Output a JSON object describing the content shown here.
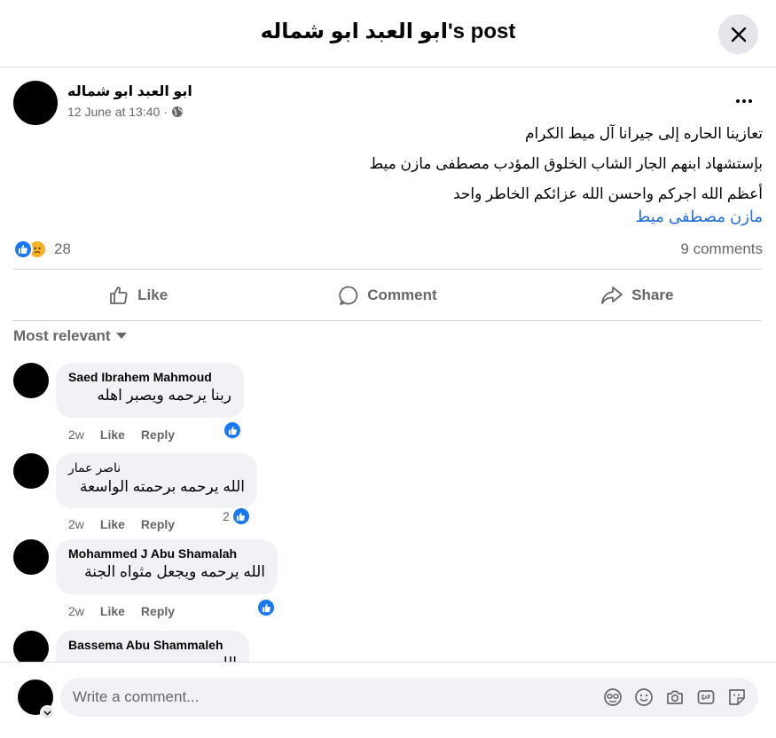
{
  "header": {
    "title": "ابو العبد ابو شماله's post"
  },
  "post": {
    "author": "ابو العبد ابو شماله",
    "timestamp": "12 June at 13:40 ·",
    "lines": [
      "تعازينا الحاره إلى جيرانا آل ميط الكرام",
      "بإستشهاد ابنهم الجار الشاب الخلوق المؤدب مصطفى مازن ميط",
      "أعظم الله اجركم واحسن الله عزائكم الخاطر واحد"
    ],
    "link_text": "مازن مصطفى ميط",
    "reaction_count": "28",
    "comment_count": "9 comments"
  },
  "actions": {
    "like": "Like",
    "comment": "Comment",
    "share": "Share"
  },
  "sort_label": "Most relevant",
  "comments": [
    {
      "author": "Saed Ibrahem Mahmoud",
      "text": "ربنا يرحمه ويصبر اهله",
      "age": "2w",
      "like": "Like",
      "reply": "Reply",
      "reactions": ""
    },
    {
      "author": "ناصر عمار",
      "text": "الله يرحمه برحمته الواسعة",
      "age": "2w",
      "like": "Like",
      "reply": "Reply",
      "reactions": "2"
    },
    {
      "author": "Mohammed J Abu Shamalah",
      "text": "الله يرحمه ويجعل مثواه الجنة",
      "age": "2w",
      "like": "Like",
      "reply": "Reply",
      "reactions": ""
    },
    {
      "author": "Bassema Abu Shammaleh",
      "text": "الله يرحمه"
    }
  ],
  "composer": {
    "placeholder": "Write a comment..."
  },
  "colors": {
    "accent": "#1877f2",
    "link": "#216fdb",
    "muted": "#65676b",
    "bubble": "#f0f2f5",
    "sad": "#f7b125"
  }
}
